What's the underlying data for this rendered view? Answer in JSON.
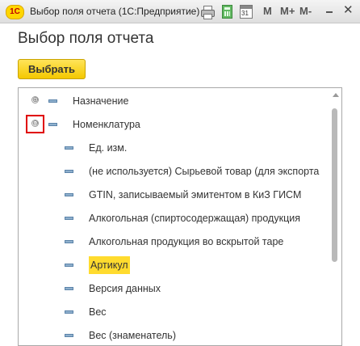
{
  "titlebar": {
    "logo_text": "1С",
    "title": "Выбор поля отчета  (1С:Предприятие)",
    "icons": [
      "printer-icon",
      "calculator-icon",
      "calendar-icon"
    ],
    "calendar_day": "31",
    "mem_buttons": [
      "M",
      "M+",
      "M-"
    ],
    "minimize_icon": "minimize-icon",
    "close_glyph": "✕"
  },
  "header": {
    "title": "Выбор поля отчета",
    "select_button": "Выбрать"
  },
  "tree": {
    "rows": [
      {
        "label": "Назначение",
        "level": 0,
        "toggle": "⊕",
        "expanded": false
      },
      {
        "label": "Номенклатура",
        "level": 0,
        "toggle": "⊖",
        "expanded": true,
        "highlighted_toggle": true
      },
      {
        "label": "Ед. изм.",
        "level": 1
      },
      {
        "label": "(не используется) Сырьевой товар (для экспорта",
        "level": 1
      },
      {
        "label": "GTIN, записываемый эмитентом в КиЗ ГИСМ",
        "level": 1
      },
      {
        "label": "Алкогольная (спиртосодержащая) продукция",
        "level": 1
      },
      {
        "label": "Алкогольная продукция во вскрытой таре",
        "level": 1
      },
      {
        "label": "Артикул",
        "level": 1,
        "selected": true
      },
      {
        "label": "Версия данных",
        "level": 1
      },
      {
        "label": "Вес",
        "level": 1
      },
      {
        "label": "Вес (знаменатель)",
        "level": 1
      }
    ]
  },
  "colors": {
    "accent_yellow": "#f4c800",
    "selection": "#ffdb2e",
    "highlight_border": "#e00000",
    "field_icon": "#8fb0cd"
  }
}
